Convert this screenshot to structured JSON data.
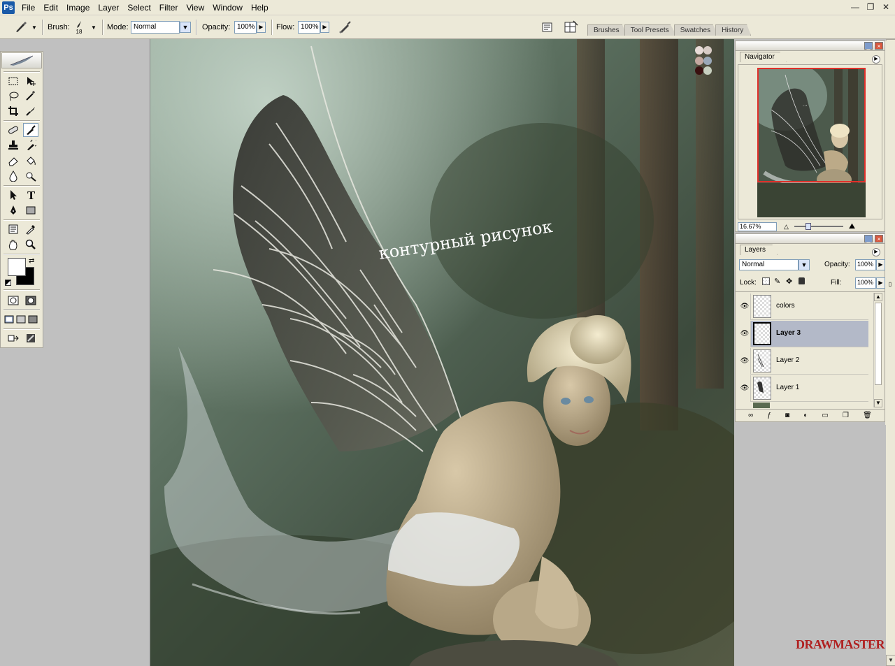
{
  "menu": {
    "items": [
      "File",
      "Edit",
      "Image",
      "Layer",
      "Select",
      "Filter",
      "View",
      "Window",
      "Help"
    ]
  },
  "window_controls": {
    "minimize": "—",
    "restore": "❐",
    "close": "✕"
  },
  "options_bar": {
    "brush_label": "Brush:",
    "brush_size": "18",
    "mode_label": "Mode:",
    "mode_value": "Normal",
    "opacity_label": "Opacity:",
    "opacity_value": "100%",
    "flow_label": "Flow:",
    "flow_value": "100%"
  },
  "palette_well": {
    "tabs": [
      "Brushes",
      "Tool Presets",
      "Swatches",
      "History"
    ]
  },
  "canvas": {
    "annotation": "контурный рисунок",
    "watermark": "DRAWMASTER.RU"
  },
  "navigator": {
    "tab": "Navigator",
    "zoom": "16.67%",
    "zoom_fraction": 0.25
  },
  "layers": {
    "tab": "Layers",
    "blend_mode": "Normal",
    "opacity_label": "Opacity:",
    "opacity_value": "100%",
    "lock_label": "Lock:",
    "fill_label": "Fill:",
    "fill_value": "100%",
    "rows": [
      {
        "name": "colors",
        "selected": false
      },
      {
        "name": "Layer 3",
        "selected": true
      },
      {
        "name": "Layer 2",
        "selected": false
      },
      {
        "name": "Layer 1",
        "selected": false
      }
    ]
  },
  "colors": {
    "foreground": "#ffffff",
    "background": "#000000",
    "palette_swatches": [
      "#e8dcd8",
      "#c4a8a0",
      "#9aa8b8",
      "#c8d0c0",
      "#3a1010"
    ]
  }
}
